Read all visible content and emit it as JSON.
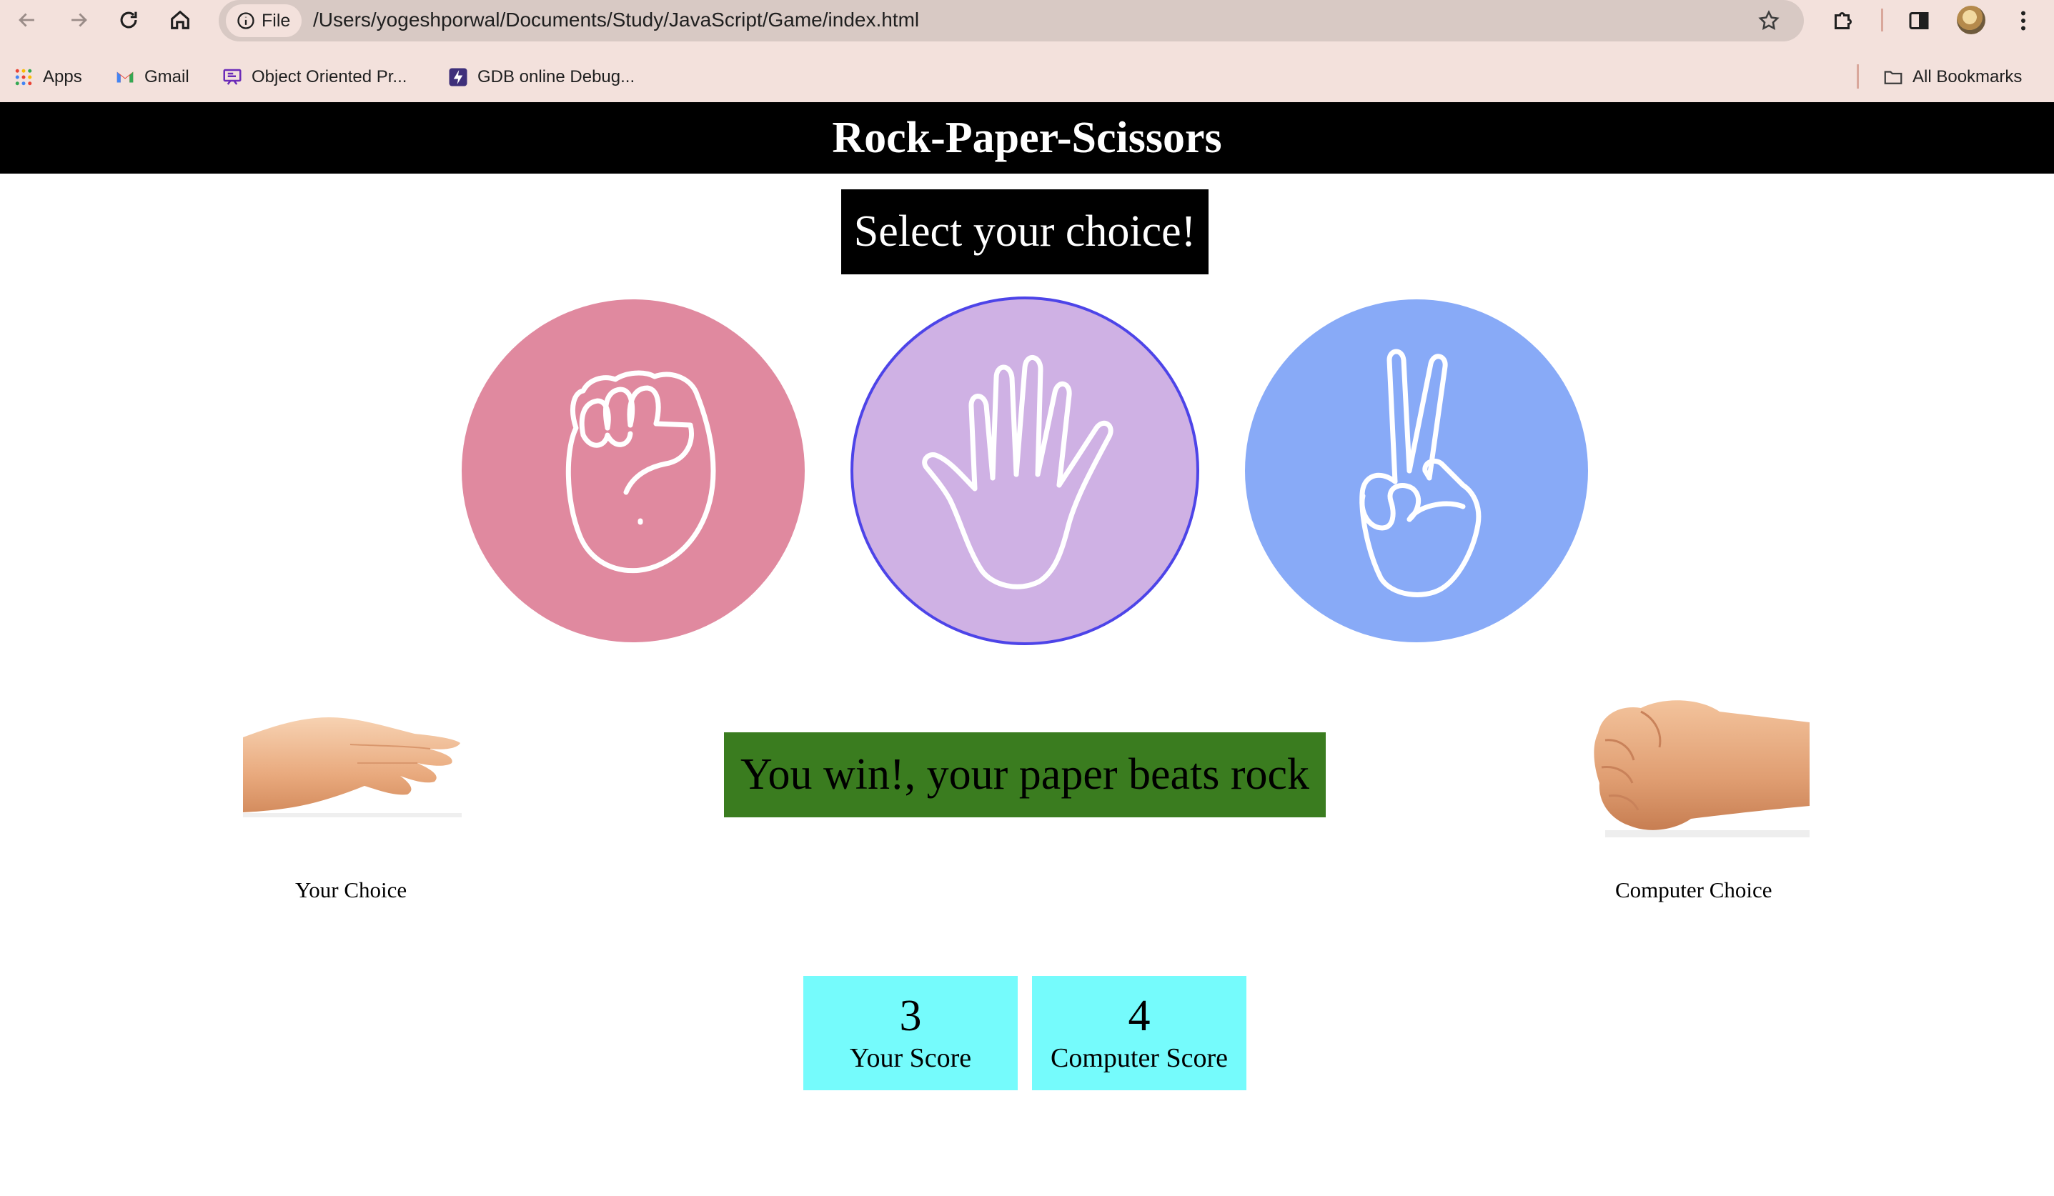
{
  "browser": {
    "file_chip": "File",
    "url": "/Users/yogeshporwal/Documents/Study/JavaScript/Game/index.html",
    "bookmarks": [
      {
        "label": "Apps",
        "icon": "apps-grid-icon"
      },
      {
        "label": "Gmail",
        "icon": "gmail-icon"
      },
      {
        "label": "Object Oriented Pr...",
        "icon": "presentation-icon"
      },
      {
        "label": "GDB online Debug...",
        "icon": "lightning-icon"
      }
    ],
    "all_bookmarks": "All Bookmarks"
  },
  "page": {
    "title": "Rock-Paper-Scissors",
    "prompt": "Select your choice!",
    "choices": [
      {
        "id": "rock",
        "icon": "fist-icon",
        "color": "#e0899f"
      },
      {
        "id": "paper",
        "icon": "open-hand-icon",
        "color": "#cfb1e4",
        "selected": true
      },
      {
        "id": "scissors",
        "icon": "peace-hand-icon",
        "color": "#88aaf7"
      }
    ],
    "result_message": "You win!, your paper beats rock",
    "result_color": "#3a7c1f",
    "your_choice_label": "Your Choice",
    "computer_choice_label": "Computer Choice",
    "scores": {
      "your_score": "3",
      "your_score_label": "Your Score",
      "computer_score": "4",
      "computer_score_label": "Computer Score",
      "card_color": "#75fbfc"
    }
  }
}
